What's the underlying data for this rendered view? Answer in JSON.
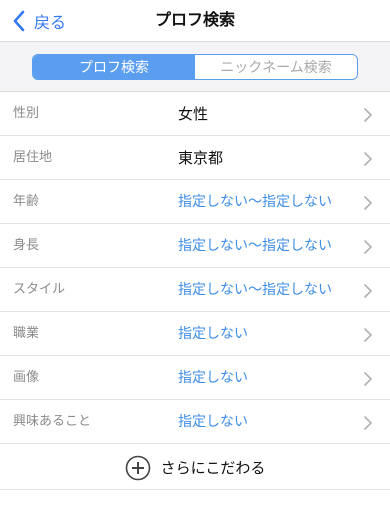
{
  "nav": {
    "back_label": "戻る",
    "title": "プロフ検索"
  },
  "segments": [
    {
      "label": "プロフ検索",
      "active": true
    },
    {
      "label": "ニックネーム検索",
      "active": false
    }
  ],
  "rows": [
    {
      "label": "性別",
      "value": "女性",
      "value_style": "dark"
    },
    {
      "label": "居住地",
      "value": "東京都",
      "value_style": "dark"
    },
    {
      "label": "年齢",
      "value": "指定しない～指定しない",
      "value_style": "blue"
    },
    {
      "label": "身長",
      "value": "指定しない～指定しない",
      "value_style": "blue"
    },
    {
      "label": "スタイル",
      "value": "指定しない～指定しない",
      "value_style": "blue"
    },
    {
      "label": "職業",
      "value": "指定しない",
      "value_style": "blue"
    },
    {
      "label": "画像",
      "value": "指定しない",
      "value_style": "blue"
    },
    {
      "label": "興味あること",
      "value": "指定しない",
      "value_style": "blue"
    }
  ],
  "more": {
    "label": "さらにこだわる",
    "icon": "plus-circle-icon"
  },
  "colors": {
    "accent": "#3478f6",
    "segment_active": "#5b9ef0",
    "value_blue": "#3f8ee6"
  }
}
